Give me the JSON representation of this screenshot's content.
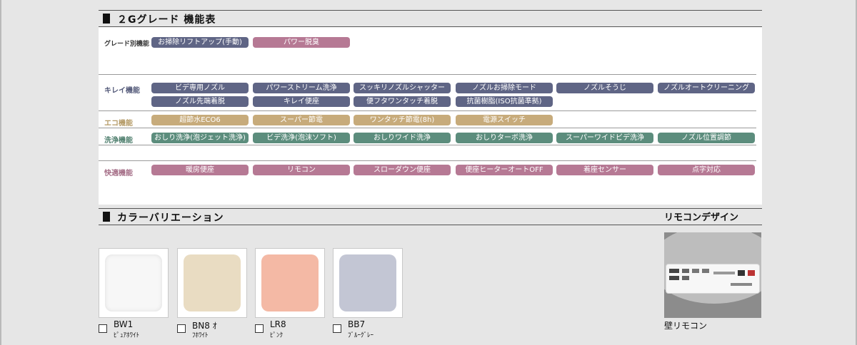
{
  "sections": {
    "features_title": "２Gグレード 機能表",
    "color_title": "カラーバリエーション",
    "remote_title": "リモコンデザイン"
  },
  "rows": {
    "grade": {
      "label": "グレード別機能",
      "items": [
        "お掃除リフトアップ(手動)",
        "パワー脱臭"
      ],
      "colors": [
        "#5f6585",
        "#b67994"
      ]
    },
    "kirei": {
      "label": "キレイ機能",
      "items": [
        "ビデ専用ノズル",
        "パワーストリーム洗浄",
        "スッキリノズルシャッター",
        "ノズルお掃除モード",
        "ノズルそうじ",
        "ノズルオートクリーニング",
        "ノズル先端着脱",
        "キレイ便座",
        "便フタワンタッチ着脱",
        "抗菌樹脂(ISO抗菌準拠)"
      ],
      "color": "#5f6585"
    },
    "eco": {
      "label": "エコ機能",
      "items": [
        "超節水ECO6",
        "スーパー節電",
        "ワンタッチ節電(8h)",
        "電源スイッチ"
      ],
      "color": "#c7ab7b"
    },
    "sen": {
      "label": "洗浄機能",
      "items": [
        "おしり洗浄(泡ジェット洗浄)",
        "ビデ洗浄(泡沫ソフト)",
        "おしりワイド洗浄",
        "おしりターボ洗浄",
        "スーパーワイドビデ洗浄",
        "ノズル位置調節"
      ],
      "color": "#5c8d7d"
    },
    "kai": {
      "label": "快適機能",
      "items": [
        "暖房便座",
        "リモコン",
        "スローダウン便座",
        "便座ヒーターオートOFF",
        "着座センサー",
        "点字対応"
      ],
      "color": "#b67994"
    }
  },
  "colors": [
    {
      "code": "BW1",
      "name": "ﾋﾟｭｱﾎﾜｲﾄ",
      "hex": "#f7f7f7"
    },
    {
      "code": "BN8 ｵ",
      "name": "ﾌﾎﾜｲﾄ",
      "hex": "#e9dcc2"
    },
    {
      "code": "LR8",
      "name": "ﾋﾟﾝｸ",
      "hex": "#f4b9a5"
    },
    {
      "code": "BB7",
      "name": "ﾌﾞﾙｰｸﾞﾚｰ",
      "hex": "#c3c6d4"
    }
  ],
  "remote": {
    "caption": "壁リモコン"
  }
}
